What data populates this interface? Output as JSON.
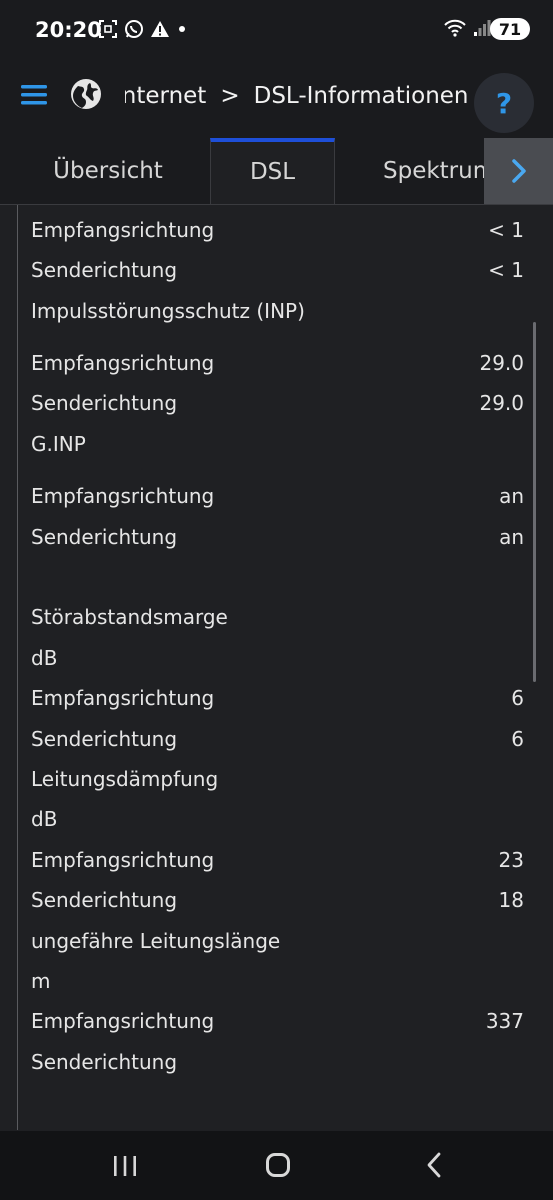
{
  "status_bar": {
    "time": "20:20",
    "battery": "71"
  },
  "header": {
    "breadcrumb_parent": "Internet",
    "breadcrumb_separator": ">",
    "breadcrumb_current": "DSL-Informationen",
    "help_label": "?"
  },
  "tabs": [
    {
      "label": "Übersicht",
      "active": false
    },
    {
      "label": "DSL",
      "active": true
    },
    {
      "label": "Spektrum",
      "active": false
    }
  ],
  "rows": [
    {
      "label": "Empfangsrichtung",
      "value": "< 1"
    },
    {
      "label": "Senderichtung",
      "value": "< 1"
    },
    {
      "label": "Impulsstörungsschutz (INP)",
      "value": ""
    },
    {
      "label": "Empfangsrichtung",
      "value": "29.0"
    },
    {
      "label": "Senderichtung",
      "value": "29.0"
    },
    {
      "label": "G.INP",
      "value": ""
    },
    {
      "label": "Empfangsrichtung",
      "value": "an"
    },
    {
      "label": "Senderichtung",
      "value": "an"
    },
    {
      "label": "Störabstandsmarge",
      "value": ""
    },
    {
      "label": "dB",
      "value": ""
    },
    {
      "label": "Empfangsrichtung",
      "value": "6"
    },
    {
      "label": "Senderichtung",
      "value": "6"
    },
    {
      "label": "Leitungsdämpfung",
      "value": ""
    },
    {
      "label": "dB",
      "value": ""
    },
    {
      "label": "Empfangsrichtung",
      "value": "23"
    },
    {
      "label": "Senderichtung",
      "value": "18"
    },
    {
      "label": "ungefähre Leitungslänge",
      "value": ""
    },
    {
      "label": "m",
      "value": ""
    },
    {
      "label": "Empfangsrichtung",
      "value": "337"
    },
    {
      "label": "Senderichtung",
      "value": ""
    }
  ],
  "colors": {
    "accent_blue": "#2f96e8",
    "active_tab_indicator": "#1e4fd8",
    "background": "#1f2023"
  }
}
